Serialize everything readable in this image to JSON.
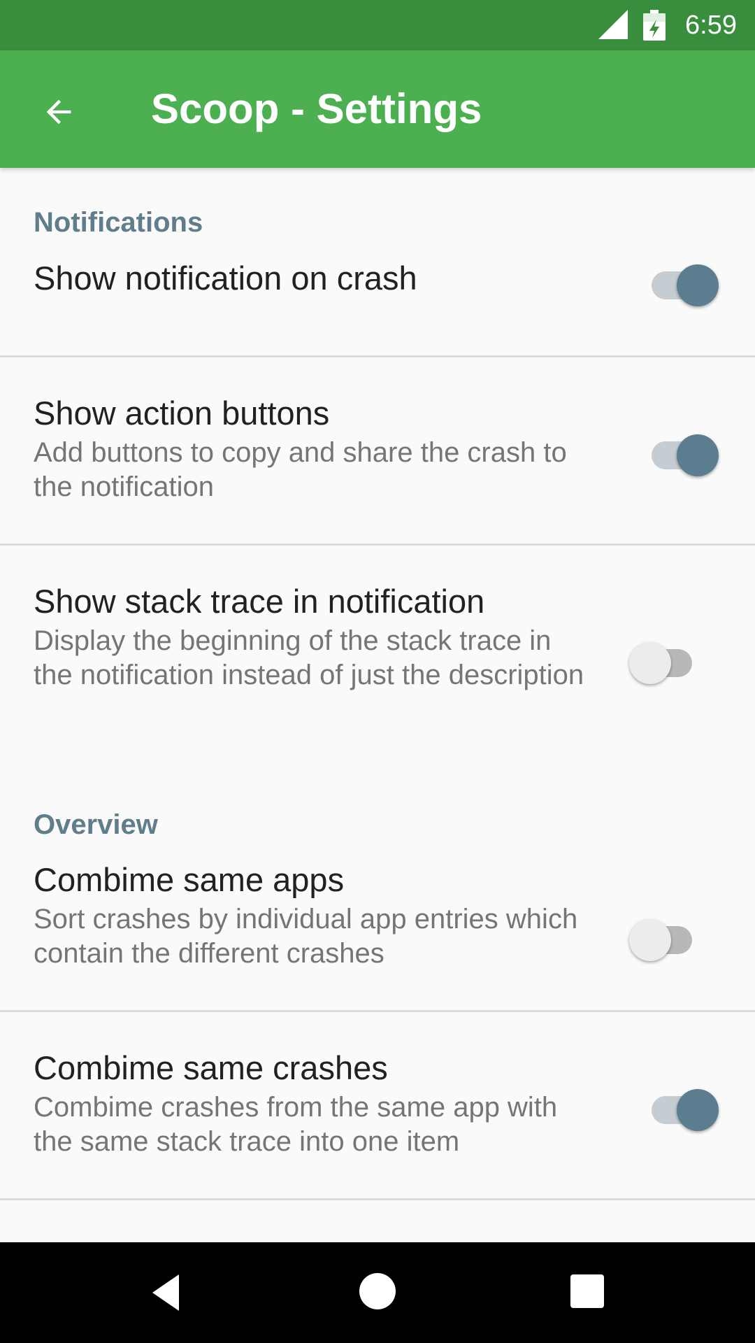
{
  "status_bar": {
    "time": "6:59",
    "icons": [
      "signal-icon",
      "battery-charging-icon"
    ],
    "color": "#388e3c"
  },
  "app_bar": {
    "title": "Scoop - Settings",
    "back_icon": "arrow-back-icon",
    "color": "#4caf50"
  },
  "sections": [
    {
      "header": "Notifications",
      "items": [
        {
          "title": "Show notification on crash",
          "summary": "",
          "enabled": true
        },
        {
          "title": "Show action buttons",
          "summary": "Add buttons to copy and share the crash to the notification",
          "enabled": true
        },
        {
          "title": "Show stack trace in notification",
          "summary": "Display the beginning of the stack trace in the notification instead of just the description",
          "enabled": false
        }
      ]
    },
    {
      "header": "Overview",
      "items": [
        {
          "title": "Combime same apps",
          "summary": "Sort crashes by individual app entries which contain the different crashes",
          "enabled": false
        },
        {
          "title": "Combime same crashes",
          "summary": "Combime crashes from the same app with the same stack trace into one item",
          "enabled": true
        }
      ]
    }
  ],
  "nav_bar": {
    "icons": [
      "nav-back-icon",
      "nav-home-icon",
      "nav-recents-icon"
    ]
  },
  "colors": {
    "accent": "#607d8b",
    "switch_on_thumb": "#5c7d8f"
  }
}
